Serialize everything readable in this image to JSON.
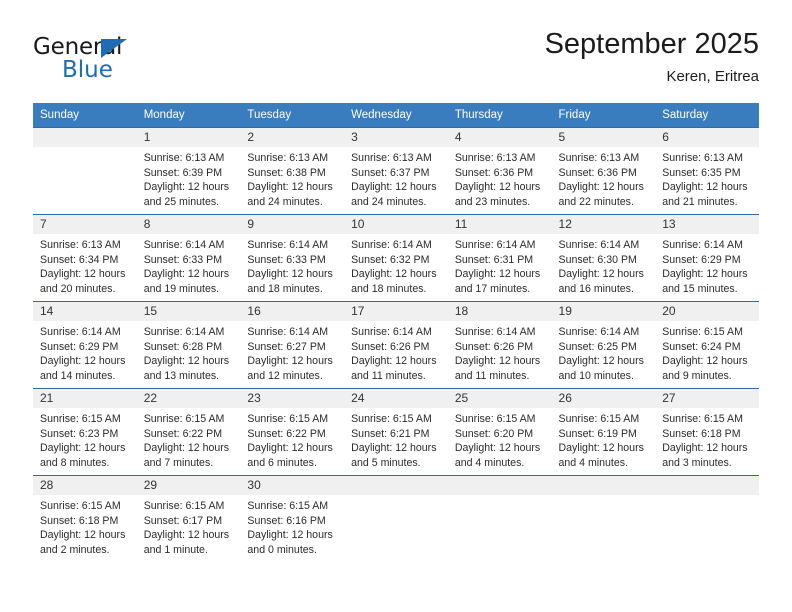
{
  "brand": {
    "name_part1": "General",
    "name_part2": "Blue"
  },
  "header": {
    "title": "September 2025",
    "subtitle": "Keren, Eritrea"
  },
  "calendar": {
    "weekday_headers": [
      "Sunday",
      "Monday",
      "Tuesday",
      "Wednesday",
      "Thursday",
      "Friday",
      "Saturday"
    ],
    "colors": {
      "header_bg": "#3a7dbf",
      "row_divider": "#2e6da4",
      "daynum_bg": "#f0f0f0",
      "brand_blue": "#1f6cb4"
    },
    "weeks": [
      [
        {
          "day": "",
          "lines": []
        },
        {
          "day": "1",
          "lines": [
            "Sunrise: 6:13 AM",
            "Sunset: 6:39 PM",
            "Daylight: 12 hours",
            "and 25 minutes."
          ]
        },
        {
          "day": "2",
          "lines": [
            "Sunrise: 6:13 AM",
            "Sunset: 6:38 PM",
            "Daylight: 12 hours",
            "and 24 minutes."
          ]
        },
        {
          "day": "3",
          "lines": [
            "Sunrise: 6:13 AM",
            "Sunset: 6:37 PM",
            "Daylight: 12 hours",
            "and 24 minutes."
          ]
        },
        {
          "day": "4",
          "lines": [
            "Sunrise: 6:13 AM",
            "Sunset: 6:36 PM",
            "Daylight: 12 hours",
            "and 23 minutes."
          ]
        },
        {
          "day": "5",
          "lines": [
            "Sunrise: 6:13 AM",
            "Sunset: 6:36 PM",
            "Daylight: 12 hours",
            "and 22 minutes."
          ]
        },
        {
          "day": "6",
          "lines": [
            "Sunrise: 6:13 AM",
            "Sunset: 6:35 PM",
            "Daylight: 12 hours",
            "and 21 minutes."
          ]
        }
      ],
      [
        {
          "day": "7",
          "lines": [
            "Sunrise: 6:13 AM",
            "Sunset: 6:34 PM",
            "Daylight: 12 hours",
            "and 20 minutes."
          ]
        },
        {
          "day": "8",
          "lines": [
            "Sunrise: 6:14 AM",
            "Sunset: 6:33 PM",
            "Daylight: 12 hours",
            "and 19 minutes."
          ]
        },
        {
          "day": "9",
          "lines": [
            "Sunrise: 6:14 AM",
            "Sunset: 6:33 PM",
            "Daylight: 12 hours",
            "and 18 minutes."
          ]
        },
        {
          "day": "10",
          "lines": [
            "Sunrise: 6:14 AM",
            "Sunset: 6:32 PM",
            "Daylight: 12 hours",
            "and 18 minutes."
          ]
        },
        {
          "day": "11",
          "lines": [
            "Sunrise: 6:14 AM",
            "Sunset: 6:31 PM",
            "Daylight: 12 hours",
            "and 17 minutes."
          ]
        },
        {
          "day": "12",
          "lines": [
            "Sunrise: 6:14 AM",
            "Sunset: 6:30 PM",
            "Daylight: 12 hours",
            "and 16 minutes."
          ]
        },
        {
          "day": "13",
          "lines": [
            "Sunrise: 6:14 AM",
            "Sunset: 6:29 PM",
            "Daylight: 12 hours",
            "and 15 minutes."
          ]
        }
      ],
      [
        {
          "day": "14",
          "lines": [
            "Sunrise: 6:14 AM",
            "Sunset: 6:29 PM",
            "Daylight: 12 hours",
            "and 14 minutes."
          ]
        },
        {
          "day": "15",
          "lines": [
            "Sunrise: 6:14 AM",
            "Sunset: 6:28 PM",
            "Daylight: 12 hours",
            "and 13 minutes."
          ]
        },
        {
          "day": "16",
          "lines": [
            "Sunrise: 6:14 AM",
            "Sunset: 6:27 PM",
            "Daylight: 12 hours",
            "and 12 minutes."
          ]
        },
        {
          "day": "17",
          "lines": [
            "Sunrise: 6:14 AM",
            "Sunset: 6:26 PM",
            "Daylight: 12 hours",
            "and 11 minutes."
          ]
        },
        {
          "day": "18",
          "lines": [
            "Sunrise: 6:14 AM",
            "Sunset: 6:26 PM",
            "Daylight: 12 hours",
            "and 11 minutes."
          ]
        },
        {
          "day": "19",
          "lines": [
            "Sunrise: 6:14 AM",
            "Sunset: 6:25 PM",
            "Daylight: 12 hours",
            "and 10 minutes."
          ]
        },
        {
          "day": "20",
          "lines": [
            "Sunrise: 6:15 AM",
            "Sunset: 6:24 PM",
            "Daylight: 12 hours",
            "and 9 minutes."
          ]
        }
      ],
      [
        {
          "day": "21",
          "lines": [
            "Sunrise: 6:15 AM",
            "Sunset: 6:23 PM",
            "Daylight: 12 hours",
            "and 8 minutes."
          ]
        },
        {
          "day": "22",
          "lines": [
            "Sunrise: 6:15 AM",
            "Sunset: 6:22 PM",
            "Daylight: 12 hours",
            "and 7 minutes."
          ]
        },
        {
          "day": "23",
          "lines": [
            "Sunrise: 6:15 AM",
            "Sunset: 6:22 PM",
            "Daylight: 12 hours",
            "and 6 minutes."
          ]
        },
        {
          "day": "24",
          "lines": [
            "Sunrise: 6:15 AM",
            "Sunset: 6:21 PM",
            "Daylight: 12 hours",
            "and 5 minutes."
          ]
        },
        {
          "day": "25",
          "lines": [
            "Sunrise: 6:15 AM",
            "Sunset: 6:20 PM",
            "Daylight: 12 hours",
            "and 4 minutes."
          ]
        },
        {
          "day": "26",
          "lines": [
            "Sunrise: 6:15 AM",
            "Sunset: 6:19 PM",
            "Daylight: 12 hours",
            "and 4 minutes."
          ]
        },
        {
          "day": "27",
          "lines": [
            "Sunrise: 6:15 AM",
            "Sunset: 6:18 PM",
            "Daylight: 12 hours",
            "and 3 minutes."
          ]
        }
      ],
      [
        {
          "day": "28",
          "lines": [
            "Sunrise: 6:15 AM",
            "Sunset: 6:18 PM",
            "Daylight: 12 hours",
            "and 2 minutes."
          ]
        },
        {
          "day": "29",
          "lines": [
            "Sunrise: 6:15 AM",
            "Sunset: 6:17 PM",
            "Daylight: 12 hours",
            "and 1 minute."
          ]
        },
        {
          "day": "30",
          "lines": [
            "Sunrise: 6:15 AM",
            "Sunset: 6:16 PM",
            "Daylight: 12 hours",
            "and 0 minutes."
          ]
        },
        {
          "day": "",
          "lines": []
        },
        {
          "day": "",
          "lines": []
        },
        {
          "day": "",
          "lines": []
        },
        {
          "day": "",
          "lines": []
        }
      ]
    ]
  }
}
